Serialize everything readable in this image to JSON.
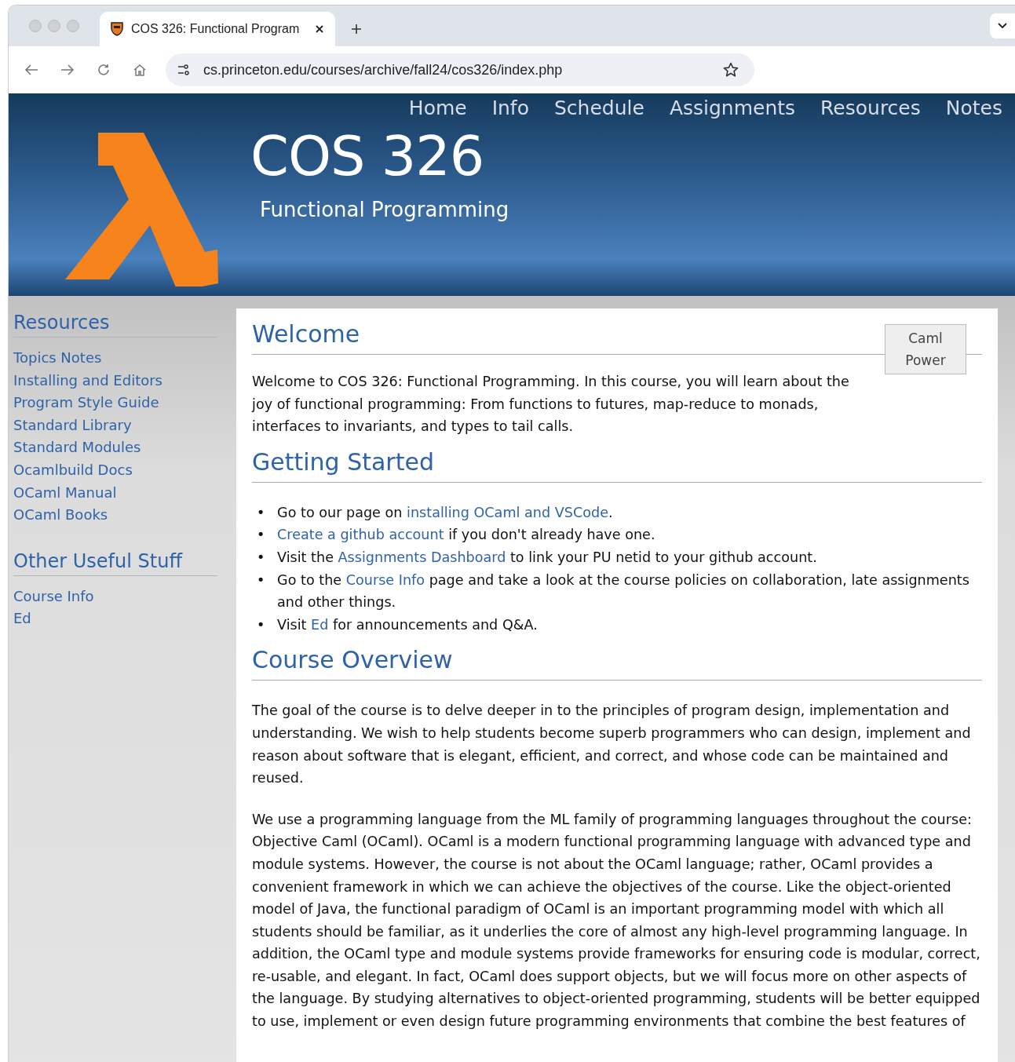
{
  "browser": {
    "tab_title": "COS 326: Functional Program",
    "url": "cs.princeton.edu/courses/archive/fall24/cos326/index.php"
  },
  "nav": [
    "Home",
    "Info",
    "Schedule",
    "Assignments",
    "Resources",
    "Notes"
  ],
  "header": {
    "title": "COS 326",
    "subtitle": "Functional Programming"
  },
  "sidebar": [
    {
      "heading": "Resources",
      "links": [
        "Topics Notes",
        "Installing and Editors",
        "Program Style Guide",
        "Standard Library",
        "Standard Modules",
        "Ocamlbuild Docs",
        "OCaml Manual",
        "OCaml Books"
      ]
    },
    {
      "heading": "Other Useful Stuff",
      "links": [
        "Course Info",
        "Ed"
      ]
    }
  ],
  "badge": [
    "Caml",
    "Power"
  ],
  "sections": [
    {
      "heading": "Welcome",
      "blocks": [
        {
          "kind": "paragraph",
          "parts": [
            {
              "text": "Welcome to COS 326: Functional Programming. In this course, you will learn about the joy of functional programming: From functions to futures, map-reduce to monads, interfaces to invariants, and types to tail calls.",
              "link": false
            }
          ]
        }
      ]
    },
    {
      "heading": "Getting Started",
      "blocks": [
        {
          "kind": "list",
          "marker": "•",
          "items": [
            [
              {
                "text": "Go to our page on ",
                "link": false
              },
              {
                "text": "installing OCaml and VSCode",
                "link": true
              },
              {
                "text": ".",
                "link": false
              }
            ],
            [
              {
                "text": "Create a github account",
                "link": true
              },
              {
                "text": " if you don't already have one.",
                "link": false
              }
            ],
            [
              {
                "text": "Visit the ",
                "link": false
              },
              {
                "text": "Assignments Dashboard",
                "link": true
              },
              {
                "text": " to link your PU netid to your github account.",
                "link": false
              }
            ],
            [
              {
                "text": "Go to the ",
                "link": false
              },
              {
                "text": "Course Info",
                "link": true
              },
              {
                "text": " page and take a look at the course policies on collaboration, late assignments and other things.",
                "link": false
              }
            ],
            [
              {
                "text": "Visit ",
                "link": false
              },
              {
                "text": "Ed",
                "link": true
              },
              {
                "text": " for announcements and Q&A.",
                "link": false
              }
            ]
          ]
        }
      ]
    },
    {
      "heading": "Course Overview",
      "blocks": [
        {
          "kind": "paragraph",
          "parts": [
            {
              "text": "The goal of the course is to delve deeper in to the principles of program design, implementation and understanding. We wish to help students become superb programmers who can design, implement and reason about software that is elegant, efficient, and correct, and whose code can be maintained and reused.",
              "link": false
            }
          ]
        },
        {
          "kind": "paragraph",
          "parts": [
            {
              "text": "We use a programming language from the ML family of programming languages throughout the course: Objective Caml (OCaml). OCaml is a modern functional programming language with advanced type and module systems. However, the course is not about the OCaml language; rather, OCaml provides a convenient framework in which we can achieve the objectives of the course. Like the object-oriented model of Java, the functional paradigm of OCaml is an important programming model with which all students should be familiar, as it underlies the core of almost any high-level programming language. In addition, the OCaml type and module systems provide frameworks for ensuring code is modular, correct, re-usable, and elegant. In fact, OCaml does support objects, but we will focus more on other aspects of the language. By studying alternatives to object-oriented programming, students will be better equipped to use, implement or even design future programming environments that combine the best features of",
              "link": false
            }
          ]
        }
      ]
    }
  ]
}
